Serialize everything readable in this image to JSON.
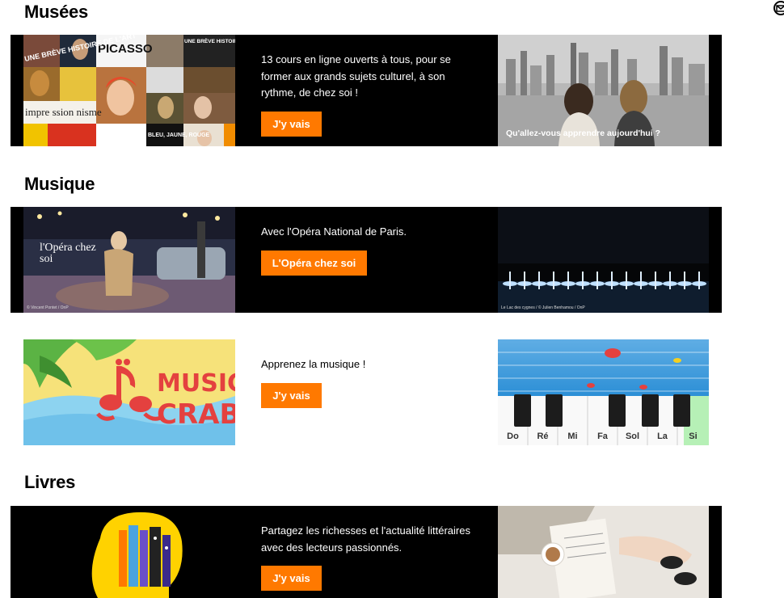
{
  "sections": {
    "musees": {
      "title": "Musées",
      "text": "13 cours en ligne ouverts à tous, pour se former aux grands sujets culturel, à son rythme, de chez soi !",
      "button": "J'y vais",
      "left_image": {
        "labels": [
          "PICASSO",
          "UNE BRÈVE HISTOIRE DE L'ART",
          "UNE BRÈVE HISTOIRE DE LA PHOTOGRAPHIE",
          "impre ssion nisme",
          "BLEU, JAUNE, ROUGE"
        ]
      },
      "right_image": {
        "overlay": "Qu'allez-vous apprendre aujourd'hui ?"
      }
    },
    "musique": {
      "title": "Musique",
      "opera": {
        "text": "Avec l'Opéra National de Paris.",
        "button": "L'Opéra chez soi",
        "left_logo": "l'Opéra chez soi",
        "left_credit": "© Vincent Pontet / OnP",
        "right_credit": "Le Lac des cygnes / © Julien Benhamou / OnP"
      },
      "crab": {
        "text": "Apprenez la musique !",
        "button": "J'y vais",
        "logo_line1": "MUSIC",
        "logo_line2": "CRAB",
        "notes": [
          "Do",
          "Ré",
          "Mi",
          "Fa",
          "Sol",
          "La",
          "Si"
        ]
      }
    },
    "livres": {
      "title": "Livres",
      "text": "Partagez les richesses et l'actualité littéraires avec des lecteurs passionnés.",
      "button": "J'y vais"
    }
  },
  "colors": {
    "accent": "#ff7900",
    "band": "#000000"
  },
  "icons": {
    "corner": "mail-close-icon"
  }
}
